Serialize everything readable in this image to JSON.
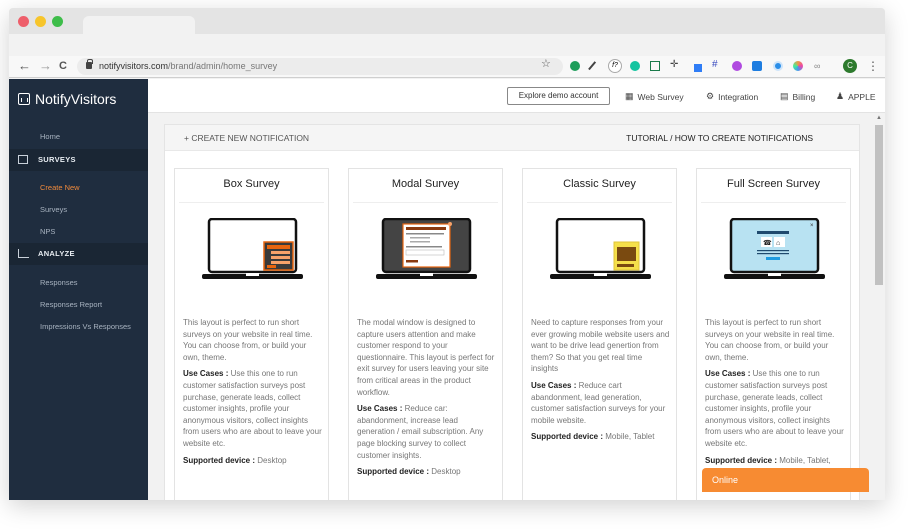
{
  "browser": {
    "url_domain": "notifyvisitors.com",
    "url_path": "/brand/admin/home_survey",
    "nav": {
      "back": "←",
      "forward": "→",
      "reload": "C"
    },
    "profile_initial": "C",
    "extensions": [
      "green-dot-ext",
      "eyedropper-ext",
      "font-ext",
      "grammarly-ext",
      "crop-ext",
      "move-ext",
      "color-picker-ext",
      "grid-ext",
      "purple-ext",
      "screenshot-ext",
      "record-ext",
      "colorful-ext",
      "cloud-ext"
    ]
  },
  "sidebar": {
    "brand": "NotifyVisitors",
    "home": "Home",
    "sections": [
      {
        "title": "SURVEYS",
        "items": [
          "Create New",
          "Surveys",
          "NPS"
        ]
      },
      {
        "title": "ANALYZE",
        "items": [
          "Responses",
          "Responses Report",
          "Impressions Vs Responses"
        ]
      }
    ],
    "active_item": "Create New"
  },
  "topbar": {
    "demo_button": "Explore demo account",
    "links": [
      {
        "icon": "grid-icon",
        "glyph": "⋮⋮⋮",
        "label": "Web Survey"
      },
      {
        "icon": "gear-icon",
        "glyph": "⚙",
        "label": "Integration"
      },
      {
        "icon": "card-icon",
        "glyph": "▤",
        "label": "Billing"
      },
      {
        "icon": "user-icon",
        "glyph": "👤",
        "label": "APPLE"
      }
    ]
  },
  "panel": {
    "create_new": "+ CREATE NEW NOTIFICATION",
    "tutorial": "TUTORIAL / HOW TO CREATE NOTIFICATIONS"
  },
  "cards": [
    {
      "title": "Box Survey",
      "description": "This layout is perfect to run short surveys on your website in real time. You can choose from, or build your own, theme.",
      "use_cases_label": "Use Cases :",
      "use_cases": "Use this one to run customer satisfaction surveys post purchase, generate leads, collect customer insights, profile your anonymous visitors, collect insights from users who are about to leave your website etc.",
      "device_label": "Supported device :",
      "device": "Desktop"
    },
    {
      "title": "Modal Survey",
      "description": "The modal window is designed to capture users attention and make customer respond to your questionnaire. This layout is perfect for exit survey for users leaving your site from critical areas in the product workflow.",
      "use_cases_label": "Use Cases :",
      "use_cases": "Reduce car: abandonment, increase lead generation / email subscription. Any page blocking survey to collect customer insights.",
      "device_label": "Supported device :",
      "device": "Desktop"
    },
    {
      "title": "Classic Survey",
      "description": "Need to capture responses from your ever growing mobile website users and want to be drive lead genertion from them? So that you get real time insights",
      "use_cases_label": "Use Cases :",
      "use_cases": "Reduce cart abandonment, lead generation, customer satisfaction surveys for your mobile website.",
      "device_label": "Supported device :",
      "device": "Mobile, Tablet"
    },
    {
      "title": "Full Screen Survey",
      "description": "This layout is perfect to run short surveys on your website in real time. You can choose from, or build your own, theme.",
      "use_cases_label": "Use Cases :",
      "use_cases": "Use this one to run customer satisfaction surveys post purchase, generate leads, collect customer insights, profile your anonymous visitors, collect insights from users who are about to leave your website etc.",
      "device_label": "Supported device :",
      "device": "Mobile, Tablet, Desktop"
    }
  ],
  "chat": {
    "label": "Online"
  },
  "colors": {
    "accent_orange": "#f78b32",
    "sidebar_bg": "#1f2d3f",
    "active_link": "#f08a3c"
  }
}
